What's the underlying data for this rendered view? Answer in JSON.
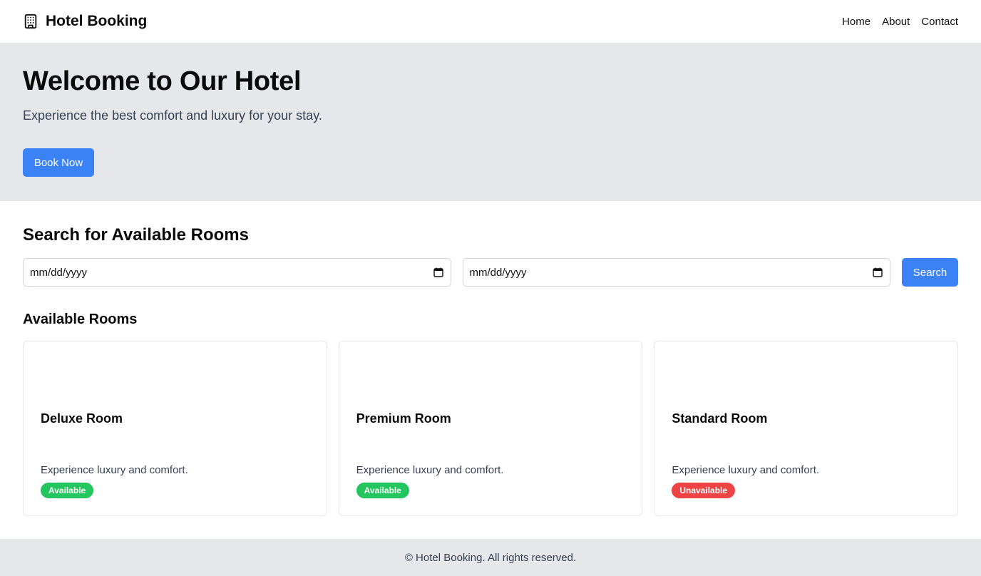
{
  "header": {
    "brand_icon": "building-icon",
    "title": "Hotel Booking",
    "nav": [
      {
        "label": "Home"
      },
      {
        "label": "About"
      },
      {
        "label": "Contact"
      }
    ]
  },
  "hero": {
    "title": "Welcome to Our Hotel",
    "subtitle": "Experience the best comfort and luxury for your stay.",
    "cta_label": "Book Now"
  },
  "search": {
    "title": "Search for Available Rooms",
    "check_in": {
      "value": "mm/dd/yyyy",
      "icon": "calendar-icon"
    },
    "check_out": {
      "value": "mm/dd/yyyy",
      "icon": "calendar-icon"
    },
    "button_label": "Search"
  },
  "rooms": {
    "title": "Available Rooms",
    "items": [
      {
        "name": "Deluxe Room",
        "description": "Experience luxury and comfort.",
        "status": "Available"
      },
      {
        "name": "Premium Room",
        "description": "Experience luxury and comfort.",
        "status": "Available"
      },
      {
        "name": "Standard Room",
        "description": "Experience luxury and comfort.",
        "status": "Unavailable"
      }
    ]
  },
  "footer": {
    "text": "© Hotel Booking. All rights reserved."
  },
  "colors": {
    "primary": "#3b82f6",
    "hero_bg": "#e5e7eb",
    "available": "#22c55e",
    "unavailable": "#ef4444"
  }
}
